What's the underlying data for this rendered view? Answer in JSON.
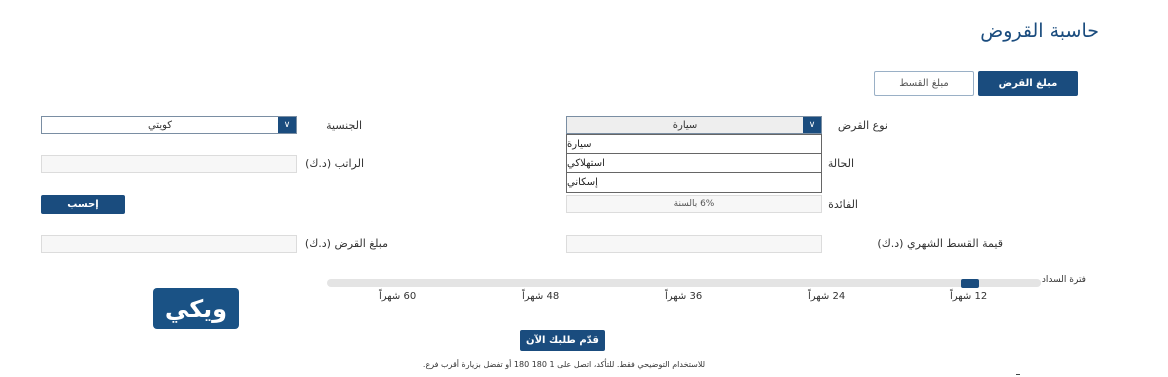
{
  "page": {
    "title": "حاسبة القروض"
  },
  "tabs": {
    "loan_amount": "مبلغ القرض",
    "installment_amount": "مبلغ القسط"
  },
  "form": {
    "loan_type_label": "نوع القرض",
    "loan_type_value": "سيارة",
    "loan_type_options": [
      "سيارة",
      "استهلاكي",
      "إسكاني"
    ],
    "nationality_label": "الجنسية",
    "nationality_value": "كويتي",
    "status_label": "الحالة",
    "salary_label": "الراتب (د.ك)",
    "interest_label": "الفائدة",
    "interest_value": "6% بالسنة",
    "monthly_installment_label": "قيمة القسط الشهري (د.ك)",
    "loan_amount_label": "مبلغ القرض (د.ك)",
    "calculate_button": "إحسب"
  },
  "slider": {
    "label": "فترة السداد",
    "ticks": [
      "12 شهراً",
      "24 شهراً",
      "36 شهراً",
      "48 شهراً",
      "60 شهراً"
    ],
    "selected_months": 12
  },
  "logo": {
    "text_main": "ويكي",
    "text_accent": "و"
  },
  "cta": {
    "apply_button": "قدّم طلبك الآن"
  },
  "disclaimer": "للاستخدام التوضيحي فقط. للتأكد، اتصل على 1 180 180 أو تفضل بزيارة أقرب فرع.",
  "colors": {
    "primary": "#1a4c7e",
    "logo_accent": "#e23b2e"
  }
}
